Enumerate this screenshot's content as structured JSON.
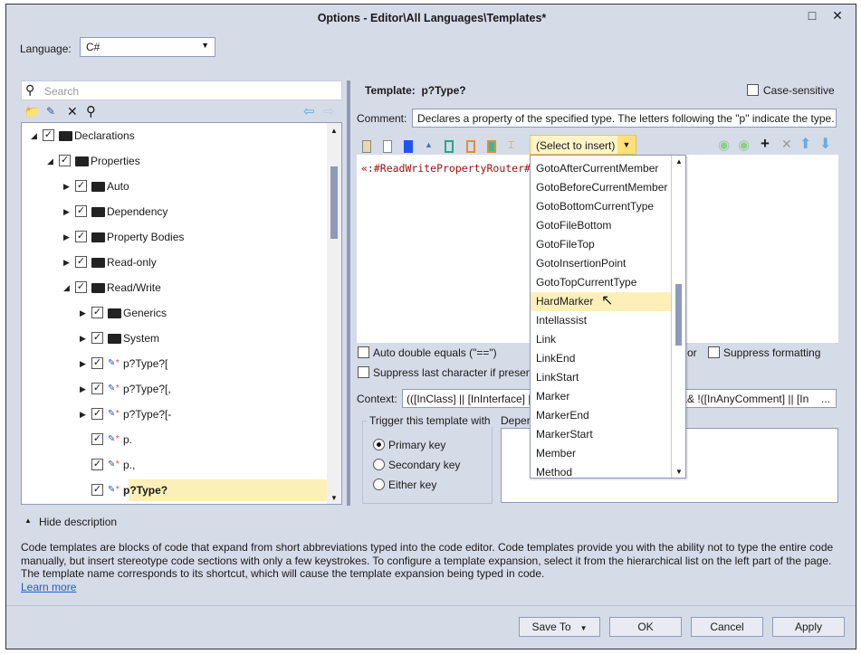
{
  "window": {
    "title": "Options - Editor\\All Languages\\Templates*"
  },
  "language": {
    "label": "Language:",
    "value": "C#"
  },
  "search": {
    "placeholder": "Search"
  },
  "tree": [
    {
      "label": "Declarations",
      "level": 0,
      "expanded": true,
      "checked": true,
      "kind": "folder"
    },
    {
      "label": "Properties",
      "level": 1,
      "expanded": true,
      "checked": true,
      "kind": "folder"
    },
    {
      "label": "Auto",
      "level": 2,
      "expanded": false,
      "checked": true,
      "kind": "folder"
    },
    {
      "label": "Dependency",
      "level": 2,
      "expanded": false,
      "checked": true,
      "kind": "folder"
    },
    {
      "label": "Property Bodies",
      "level": 2,
      "expanded": false,
      "checked": true,
      "kind": "folder"
    },
    {
      "label": "Read-only",
      "level": 2,
      "expanded": false,
      "checked": true,
      "kind": "folder"
    },
    {
      "label": "Read/Write",
      "level": 2,
      "expanded": true,
      "checked": true,
      "kind": "folder"
    },
    {
      "label": "Generics",
      "level": 3,
      "expanded": false,
      "checked": true,
      "kind": "folder"
    },
    {
      "label": "System",
      "level": 3,
      "expanded": false,
      "checked": true,
      "kind": "folder"
    },
    {
      "label": "p?Type?[",
      "level": 3,
      "expanded": false,
      "checked": true,
      "kind": "template-group"
    },
    {
      "label": "p?Type?[,",
      "level": 3,
      "expanded": false,
      "checked": true,
      "kind": "template-group"
    },
    {
      "label": "p?Type?[-",
      "level": 3,
      "expanded": false,
      "checked": true,
      "kind": "template-group"
    },
    {
      "label": "p.",
      "level": 3,
      "checked": true,
      "kind": "template"
    },
    {
      "label": "p.,",
      "level": 3,
      "checked": true,
      "kind": "template"
    },
    {
      "label": "p?Type?",
      "level": 3,
      "checked": true,
      "kind": "template",
      "selected": true
    }
  ],
  "template": {
    "label": "Template:",
    "name": "p?Type?",
    "case_sensitive": "Case-sensitive",
    "comment_label": "Comment:",
    "comment": "Declares a property of the specified type. The letters following the \"p\" indicate the type.",
    "insert_select": "(Select to insert)",
    "code": "«:#ReadWritePropertyRouter#"
  },
  "dropdown": {
    "items": [
      "GotoAfterCurrentMember",
      "GotoBeforeCurrentMember",
      "GotoBottomCurrentType",
      "GotoFileBottom",
      "GotoFileTop",
      "GotoInsertionPoint",
      "GotoTopCurrentType",
      "HardMarker",
      "Intellassist",
      "Link",
      "LinkEnd",
      "LinkStart",
      "Marker",
      "MarkerEnd",
      "MarkerStart",
      "Member",
      "Method"
    ],
    "highlighted": "HardMarker"
  },
  "options": {
    "auto_double_equals": "Auto double equals (\"==\")",
    "partial_or": "or",
    "suppress_formatting": "Suppress formatting",
    "suppress_last": "Suppress last character if present"
  },
  "context": {
    "label": "Context:",
    "value_left": "(([InClass] || [InInterface] |",
    "value_right": "&& !([InAnyComment] || [In",
    "ellipsis": "..."
  },
  "trigger": {
    "legend": "Trigger this template with",
    "options": [
      "Primary key",
      "Secondary key",
      "Either key"
    ],
    "selected": "Primary key"
  },
  "dependent": {
    "label": "Deper"
  },
  "description": {
    "toggle": "Hide description",
    "text": "Code templates are blocks of code that expand from short abbreviations typed into the code editor. Code templates provide you with the ability not to type the entire code manually, but insert stereotype code sections with only a few keystrokes. To configure a template expansion, select it from the hierarchical list on the left part of the page. The template name corresponds to its shortcut, which will cause the template expansion being typed in code.",
    "link": "Learn more"
  },
  "buttons": {
    "save_to": "Save To",
    "ok": "OK",
    "cancel": "Cancel",
    "apply": "Apply"
  }
}
